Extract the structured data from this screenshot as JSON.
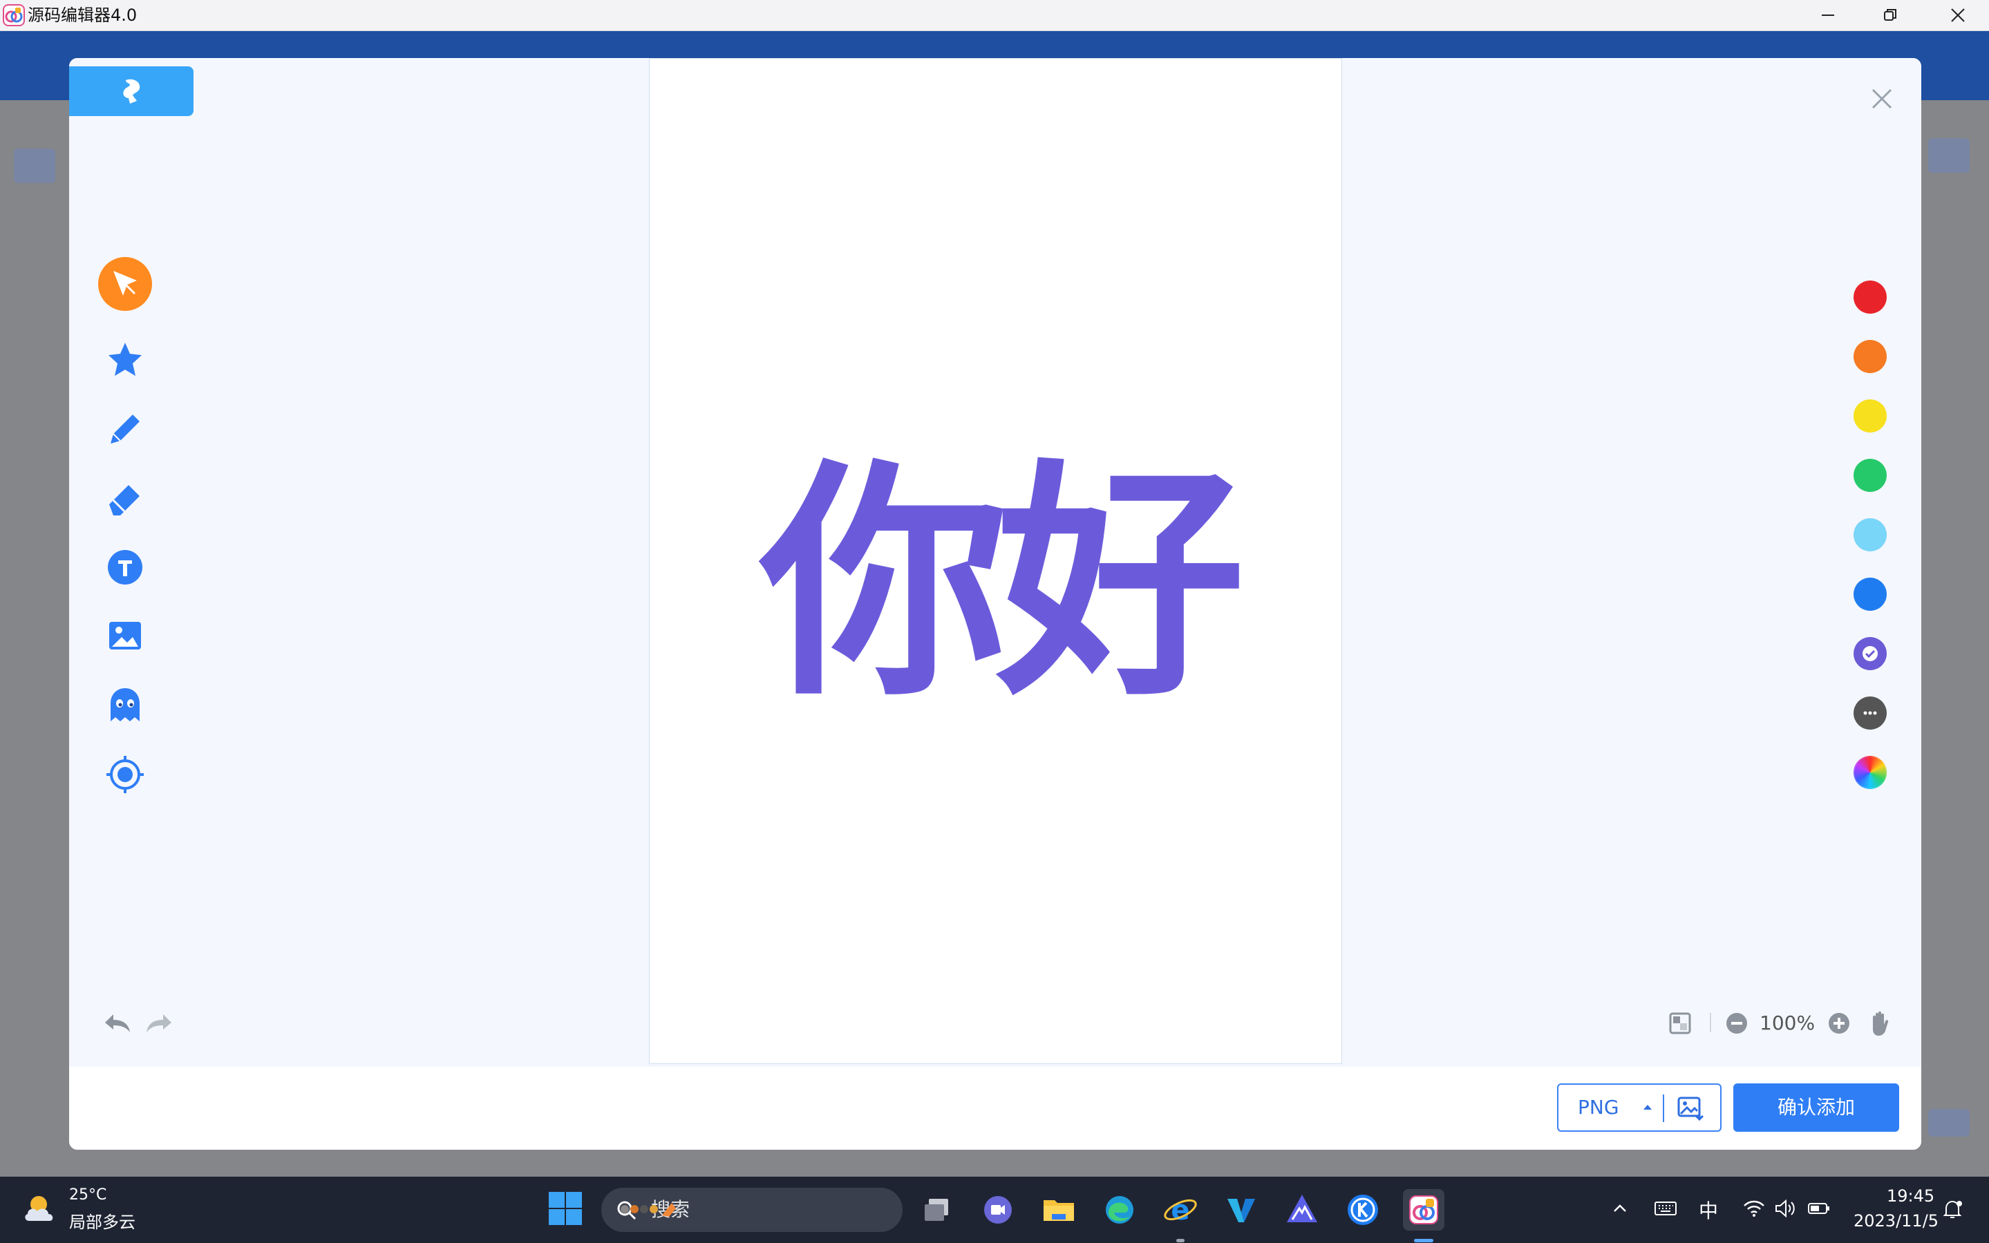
{
  "window": {
    "title": "源码编辑器4.0"
  },
  "editor": {
    "canvas_text": "你好",
    "canvas_text_color": "#6b5bdb",
    "tools": [
      "select-icon",
      "star-icon",
      "pencil-icon",
      "eraser-icon",
      "text-icon",
      "image-icon",
      "ghost-icon",
      "target-icon"
    ],
    "active_tool": "select-icon",
    "colors": [
      "#e8242a",
      "#f57a21",
      "#f7e01d",
      "#26c96a",
      "#79d6f9",
      "#1f7cf0",
      "#6c5bd6",
      "#555555"
    ],
    "selected_color": "#6c5bd6",
    "zoom": "100%"
  },
  "footer": {
    "format": "PNG",
    "confirm_label": "确认添加"
  },
  "taskbar": {
    "temperature": "25°C",
    "weather": "局部多云",
    "search_placeholder": "搜索",
    "ime": "中",
    "time": "19:45",
    "date": "2023/11/5"
  }
}
